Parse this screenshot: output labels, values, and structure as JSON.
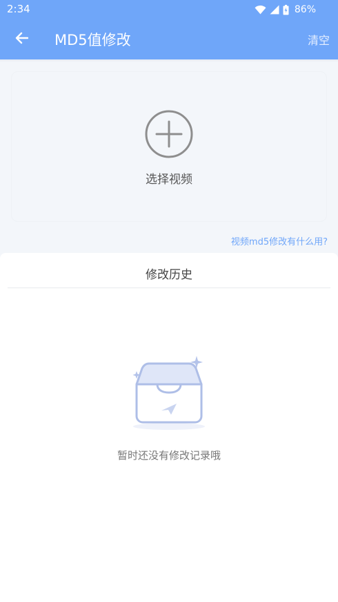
{
  "status_bar": {
    "time": "2:34",
    "battery_percent": "86%",
    "icons": [
      "wifi-icon",
      "signal-icon",
      "battery-icon"
    ]
  },
  "app_bar": {
    "back_icon": "arrow-left-icon",
    "title": "MD5值修改",
    "clear_label": "清空"
  },
  "picker": {
    "icon": "plus-circle-icon",
    "label": "选择视频"
  },
  "help_link": "视频md5修改有什么用?",
  "history": {
    "title": "修改历史",
    "empty_icon": "empty-inbox-icon",
    "empty_text": "暂时还没有修改记录哦"
  },
  "colors": {
    "accent": "#6fa6f9",
    "background": "#f3f6fa",
    "panel": "#ffffff"
  }
}
